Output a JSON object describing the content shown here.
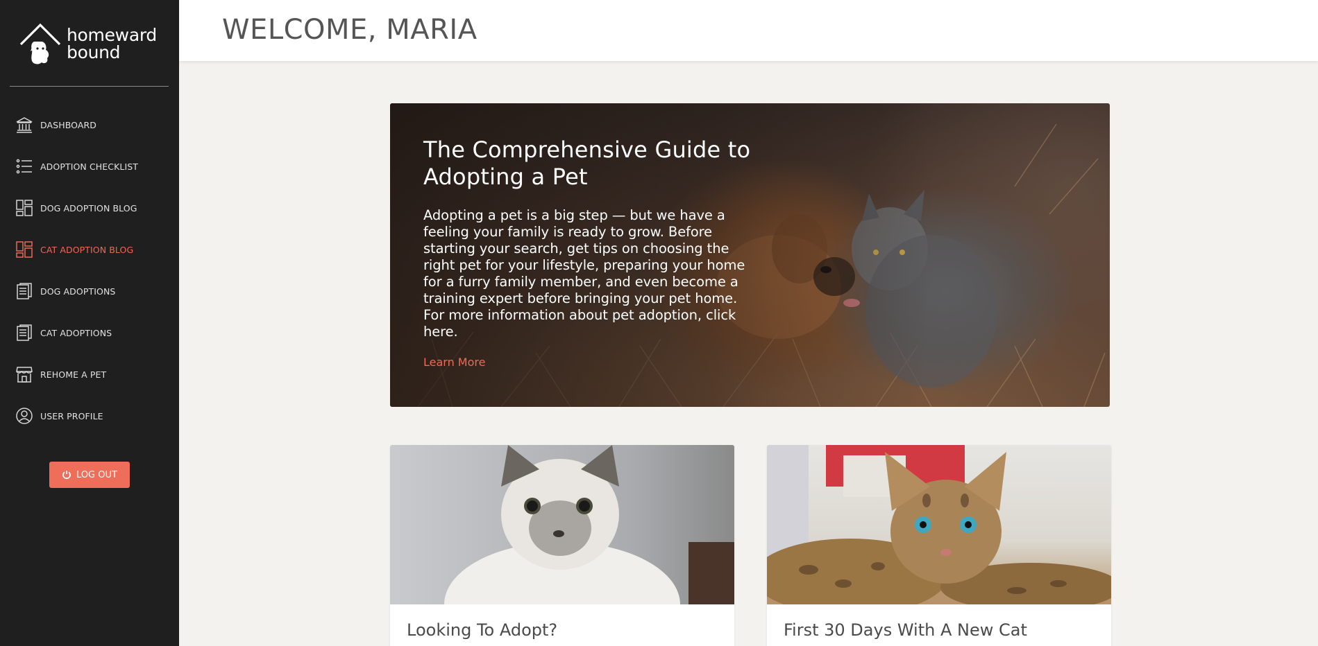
{
  "brand": {
    "line1": "homeward",
    "line2": "bound"
  },
  "sidebar": {
    "items": [
      {
        "label": "DASHBOARD",
        "icon": "bank-icon",
        "active": false
      },
      {
        "label": "ADOPTION CHECKLIST",
        "icon": "list-icon",
        "active": false
      },
      {
        "label": "DOG ADOPTION BLOG",
        "icon": "dashboard-grid-icon",
        "active": false
      },
      {
        "label": "CAT ADOPTION BLOG",
        "icon": "dashboard-grid-icon",
        "active": true
      },
      {
        "label": "DOG ADOPTIONS",
        "icon": "document-icon",
        "active": false
      },
      {
        "label": "CAT ADOPTIONS",
        "icon": "document-icon",
        "active": false
      },
      {
        "label": "REHOME A PET",
        "icon": "storefront-icon",
        "active": false
      },
      {
        "label": "USER PROFILE",
        "icon": "user-circle-icon",
        "active": false
      }
    ],
    "logout_label": "LOG OUT"
  },
  "header": {
    "title": "WELCOME, MARIA"
  },
  "hero": {
    "title": "The Comprehensive Guide to Adopting a Pet",
    "body": "Adopting a pet is a big step — but we have a feeling your family is ready to grow. Before starting your search, get tips on choosing the right pet for your lifestyle, preparing your home for a furry family member, and even become a training expert before bringing your pet home. For more information about pet adoption, click here.",
    "link_label": "Learn More"
  },
  "cards": [
    {
      "title": "Looking To Adopt?"
    },
    {
      "title": "First 30 Days With A New Cat"
    }
  ],
  "colors": {
    "accent": "#ee6e5a",
    "sidebar_bg": "#1f1f1f",
    "page_bg": "#f3f2ef"
  }
}
